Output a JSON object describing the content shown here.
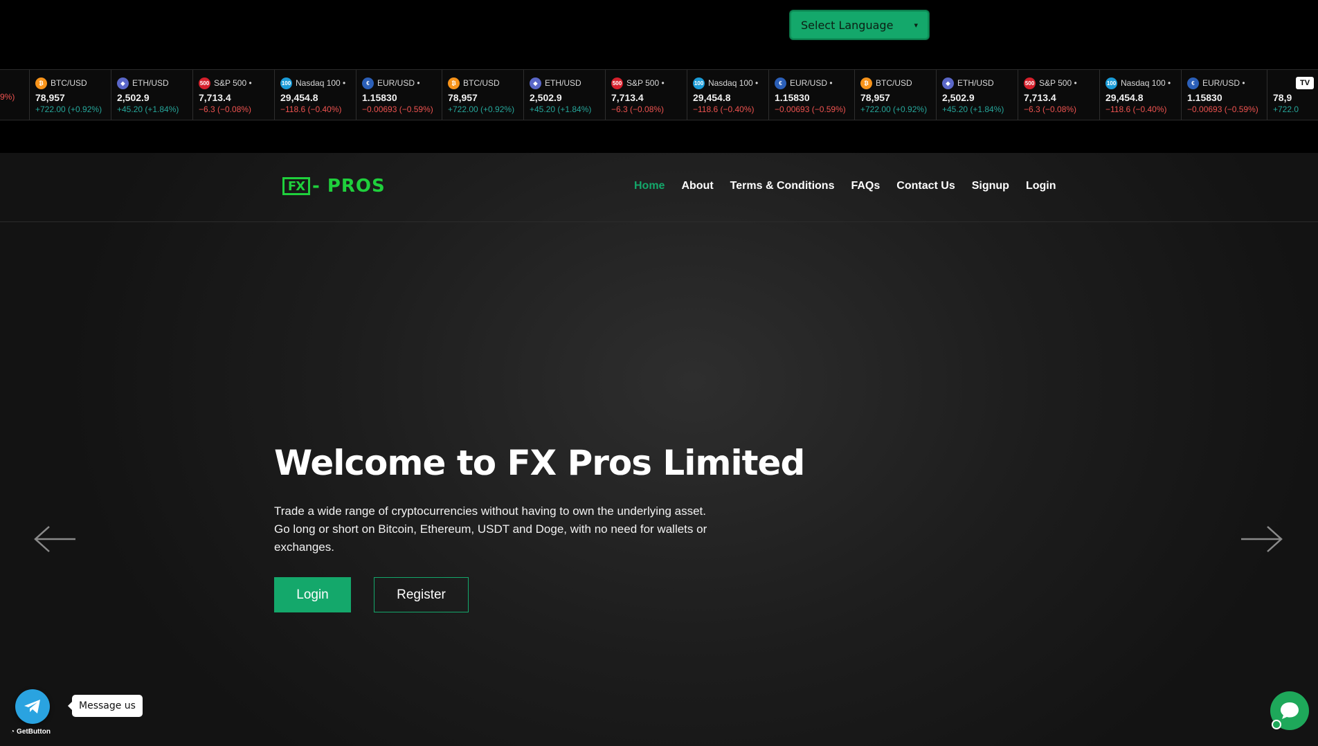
{
  "language": {
    "placeholder": "Select Language"
  },
  "ticker": [
    {
      "symbol": "",
      "price": "",
      "change": "9%)",
      "dir": "neg",
      "icon": ""
    },
    {
      "symbol": "BTC/USD",
      "price": "78,957",
      "change": "+722.00 (+0.92%)",
      "dir": "pos",
      "icon": "bitcoin-icon"
    },
    {
      "symbol": "ETH/USD",
      "price": "2,502.9",
      "change": "+45.20 (+1.84%)",
      "dir": "pos",
      "icon": "ethereum-icon"
    },
    {
      "symbol": "S&P 500 •",
      "price": "7,713.4",
      "change": "−6.3 (−0.08%)",
      "dir": "neg",
      "icon": "sp500-icon"
    },
    {
      "symbol": "Nasdaq 100 •",
      "price": "29,454.8",
      "change": "−118.6 (−0.40%)",
      "dir": "neg",
      "icon": "nasdaq-icon"
    },
    {
      "symbol": "EUR/USD •",
      "price": "1.15830",
      "change": "−0.00693 (−0.59%)",
      "dir": "neg",
      "icon": "eurusd-icon"
    },
    {
      "symbol": "BTC/USD",
      "price": "78,957",
      "change": "+722.00 (+0.92%)",
      "dir": "pos",
      "icon": "bitcoin-icon"
    },
    {
      "symbol": "ETH/USD",
      "price": "2,502.9",
      "change": "+45.20 (+1.84%)",
      "dir": "pos",
      "icon": "ethereum-icon"
    },
    {
      "symbol": "S&P 500 •",
      "price": "7,713.4",
      "change": "−6.3 (−0.08%)",
      "dir": "neg",
      "icon": "sp500-icon"
    },
    {
      "symbol": "Nasdaq 100 •",
      "price": "29,454.8",
      "change": "−118.6 (−0.40%)",
      "dir": "neg",
      "icon": "nasdaq-icon"
    },
    {
      "symbol": "EUR/USD •",
      "price": "1.15830",
      "change": "−0.00693 (−0.59%)",
      "dir": "neg",
      "icon": "eurusd-icon"
    },
    {
      "symbol": "BTC/USD",
      "price": "78,957",
      "change": "+722.00 (+0.92%)",
      "dir": "pos",
      "icon": "bitcoin-icon"
    },
    {
      "symbol": "ETH/USD",
      "price": "2,502.9",
      "change": "+45.20 (+1.84%)",
      "dir": "pos",
      "icon": "ethereum-icon"
    },
    {
      "symbol": "S&P 500 •",
      "price": "7,713.4",
      "change": "−6.3 (−0.08%)",
      "dir": "neg",
      "icon": "sp500-icon"
    },
    {
      "symbol": "Nasdaq 100 •",
      "price": "29,454.8",
      "change": "−118.6 (−0.40%)",
      "dir": "neg",
      "icon": "nasdaq-icon"
    },
    {
      "symbol": "EUR/USD •",
      "price": "1.15830",
      "change": "−0.00693 (−0.59%)",
      "dir": "neg",
      "icon": "eurusd-icon"
    },
    {
      "symbol": "",
      "price": "78,9",
      "change": "+722.0",
      "dir": "pos",
      "icon": ""
    }
  ],
  "ticker_brand": "TV",
  "logo": {
    "box": "FX",
    "text": "- PROS"
  },
  "nav": [
    {
      "label": "Home",
      "active": true
    },
    {
      "label": "About",
      "active": false
    },
    {
      "label": "Terms & Conditions",
      "active": false
    },
    {
      "label": "FAQs",
      "active": false
    },
    {
      "label": "Contact Us",
      "active": false
    },
    {
      "label": "Signup",
      "active": false
    },
    {
      "label": "Login",
      "active": false
    }
  ],
  "hero": {
    "title": "Welcome to FX Pros Limited",
    "description": "Trade a wide range of cryptocurrencies without having to own the underlying asset. Go long or short on Bitcoin, Ethereum, USDT and Doge, with no need for wallets or exchanges.",
    "login_label": "Login",
    "register_label": "Register"
  },
  "widgets": {
    "tooltip": "Message us",
    "getbutton": "GetButton"
  },
  "colors": {
    "accent": "#14a86b",
    "logo": "#1fd03c",
    "positive": "#26a69a",
    "negative": "#ef5350"
  }
}
